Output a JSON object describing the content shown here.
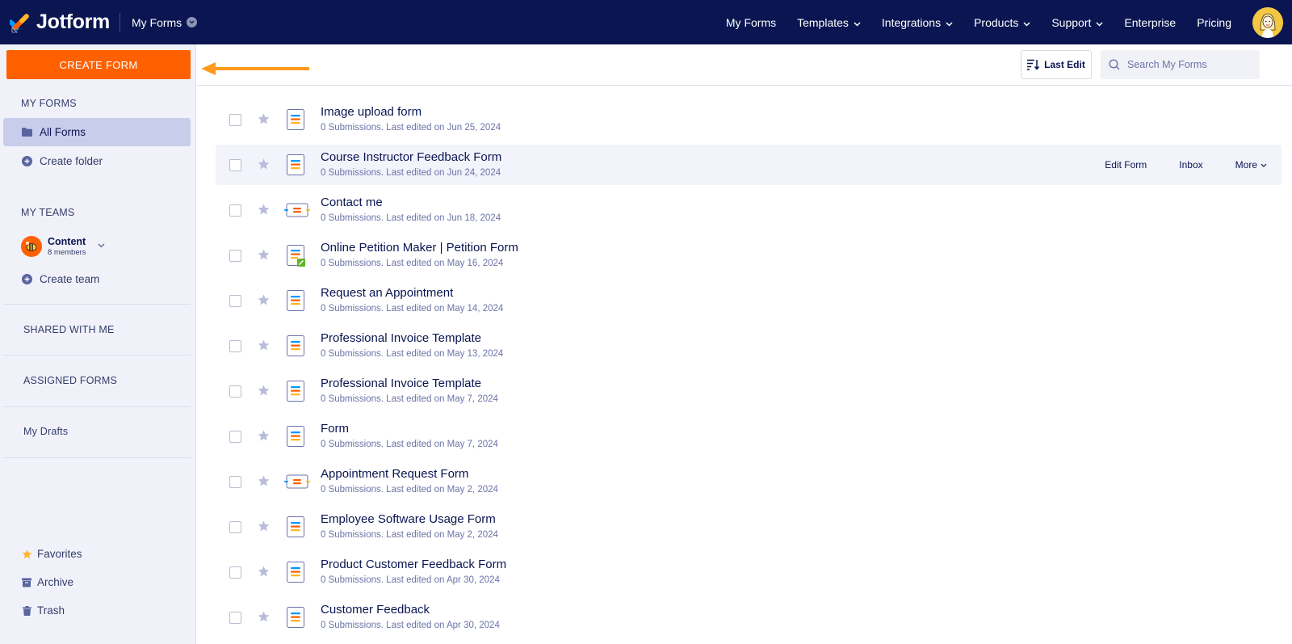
{
  "brand": {
    "name": "Jotform",
    "accent": "#ff6100",
    "navy": "#0a1551"
  },
  "header": {
    "switcher_label": "My Forms",
    "nav": [
      {
        "label": "My Forms",
        "dropdown": false
      },
      {
        "label": "Templates",
        "dropdown": true
      },
      {
        "label": "Integrations",
        "dropdown": true
      },
      {
        "label": "Products",
        "dropdown": true
      },
      {
        "label": "Support",
        "dropdown": true
      },
      {
        "label": "Enterprise",
        "dropdown": false
      },
      {
        "label": "Pricing",
        "dropdown": false
      }
    ],
    "avatar_icon": "user-avatar"
  },
  "sidebar": {
    "create_label": "CREATE FORM",
    "my_forms_heading": "MY FORMS",
    "all_forms_label": "All Forms",
    "create_folder_label": "Create folder",
    "my_teams_heading": "MY TEAMS",
    "team": {
      "name": "Content",
      "members": "8 members"
    },
    "create_team_label": "Create team",
    "shared_label": "SHARED WITH ME",
    "assigned_label": "ASSIGNED FORMS",
    "drafts_label": "My Drafts",
    "favorites_label": "Favorites",
    "archive_label": "Archive",
    "trash_label": "Trash"
  },
  "toolbar": {
    "sort_label": "Last Edit",
    "search_placeholder": "Search My Forms"
  },
  "row_actions": {
    "edit": "Edit Form",
    "inbox": "Inbox",
    "more": "More"
  },
  "forms": [
    {
      "title": "Image upload form",
      "meta": "0 Submissions. Last edited on Jun 25, 2024",
      "icon": "form-icon"
    },
    {
      "title": "Course Instructor Feedback Form",
      "meta": "0 Submissions. Last edited on Jun 24, 2024",
      "icon": "form-icon"
    },
    {
      "title": "Contact me",
      "meta": "0 Submissions. Last edited on Jun 18, 2024",
      "icon": "card-form-icon"
    },
    {
      "title": "Online Petition Maker | Petition Form",
      "meta": "0 Submissions. Last edited on May 16, 2024",
      "icon": "sign-form-icon"
    },
    {
      "title": "Request an Appointment",
      "meta": "0 Submissions. Last edited on May 14, 2024",
      "icon": "form-icon"
    },
    {
      "title": "Professional Invoice Template",
      "meta": "0 Submissions. Last edited on May 13, 2024",
      "icon": "form-icon"
    },
    {
      "title": "Professional Invoice Template",
      "meta": "0 Submissions. Last edited on May 7, 2024",
      "icon": "form-icon"
    },
    {
      "title": "Form",
      "meta": "0 Submissions. Last edited on May 7, 2024",
      "icon": "form-icon"
    },
    {
      "title": "Appointment Request Form",
      "meta": "0 Submissions. Last edited on May 2, 2024",
      "icon": "card-form-icon"
    },
    {
      "title": "Employee Software Usage Form",
      "meta": "0 Submissions. Last edited on May 2, 2024",
      "icon": "form-icon"
    },
    {
      "title": "Product Customer Feedback Form",
      "meta": "0 Submissions. Last edited on Apr 30, 2024",
      "icon": "form-icon"
    },
    {
      "title": "Customer Feedback",
      "meta": "0 Submissions. Last edited on Apr 30, 2024",
      "icon": "form-icon"
    }
  ]
}
